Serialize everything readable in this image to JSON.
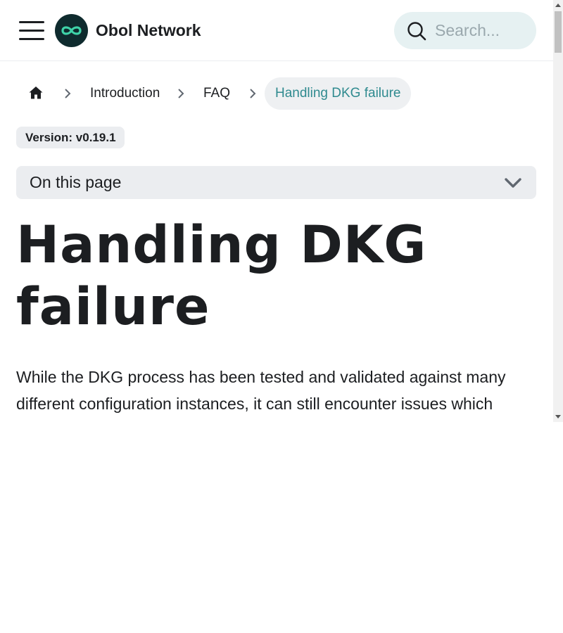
{
  "navbar": {
    "brand": "Obol Network",
    "menu_icon": "hamburger-menu-icon",
    "logo_icon": "infinity-logo-icon",
    "search": {
      "placeholder": "Search...",
      "value": "",
      "icon": "search-icon"
    }
  },
  "breadcrumb": {
    "home_icon": "home-icon",
    "separator_icon": "chevron-right-icon",
    "items": [
      {
        "label": "Introduction"
      },
      {
        "label": "FAQ"
      },
      {
        "label": "Handling DKG failure"
      }
    ]
  },
  "version_badge": "Version: v0.19.1",
  "toc": {
    "label": "On this page",
    "icon": "chevron-down-icon"
  },
  "article": {
    "title": "Handling DKG failure",
    "intro": "While the DKG process has been tested and validated against many different configuration instances, it can still encounter issues which"
  },
  "colors": {
    "accent": "#2f8a8f",
    "logo_bg": "#0f2b2e",
    "logo_mark": "#3fd3a8",
    "search_bg": "#e6f1f2",
    "chip_bg": "#ebedf0",
    "text": "#1c1e21"
  }
}
